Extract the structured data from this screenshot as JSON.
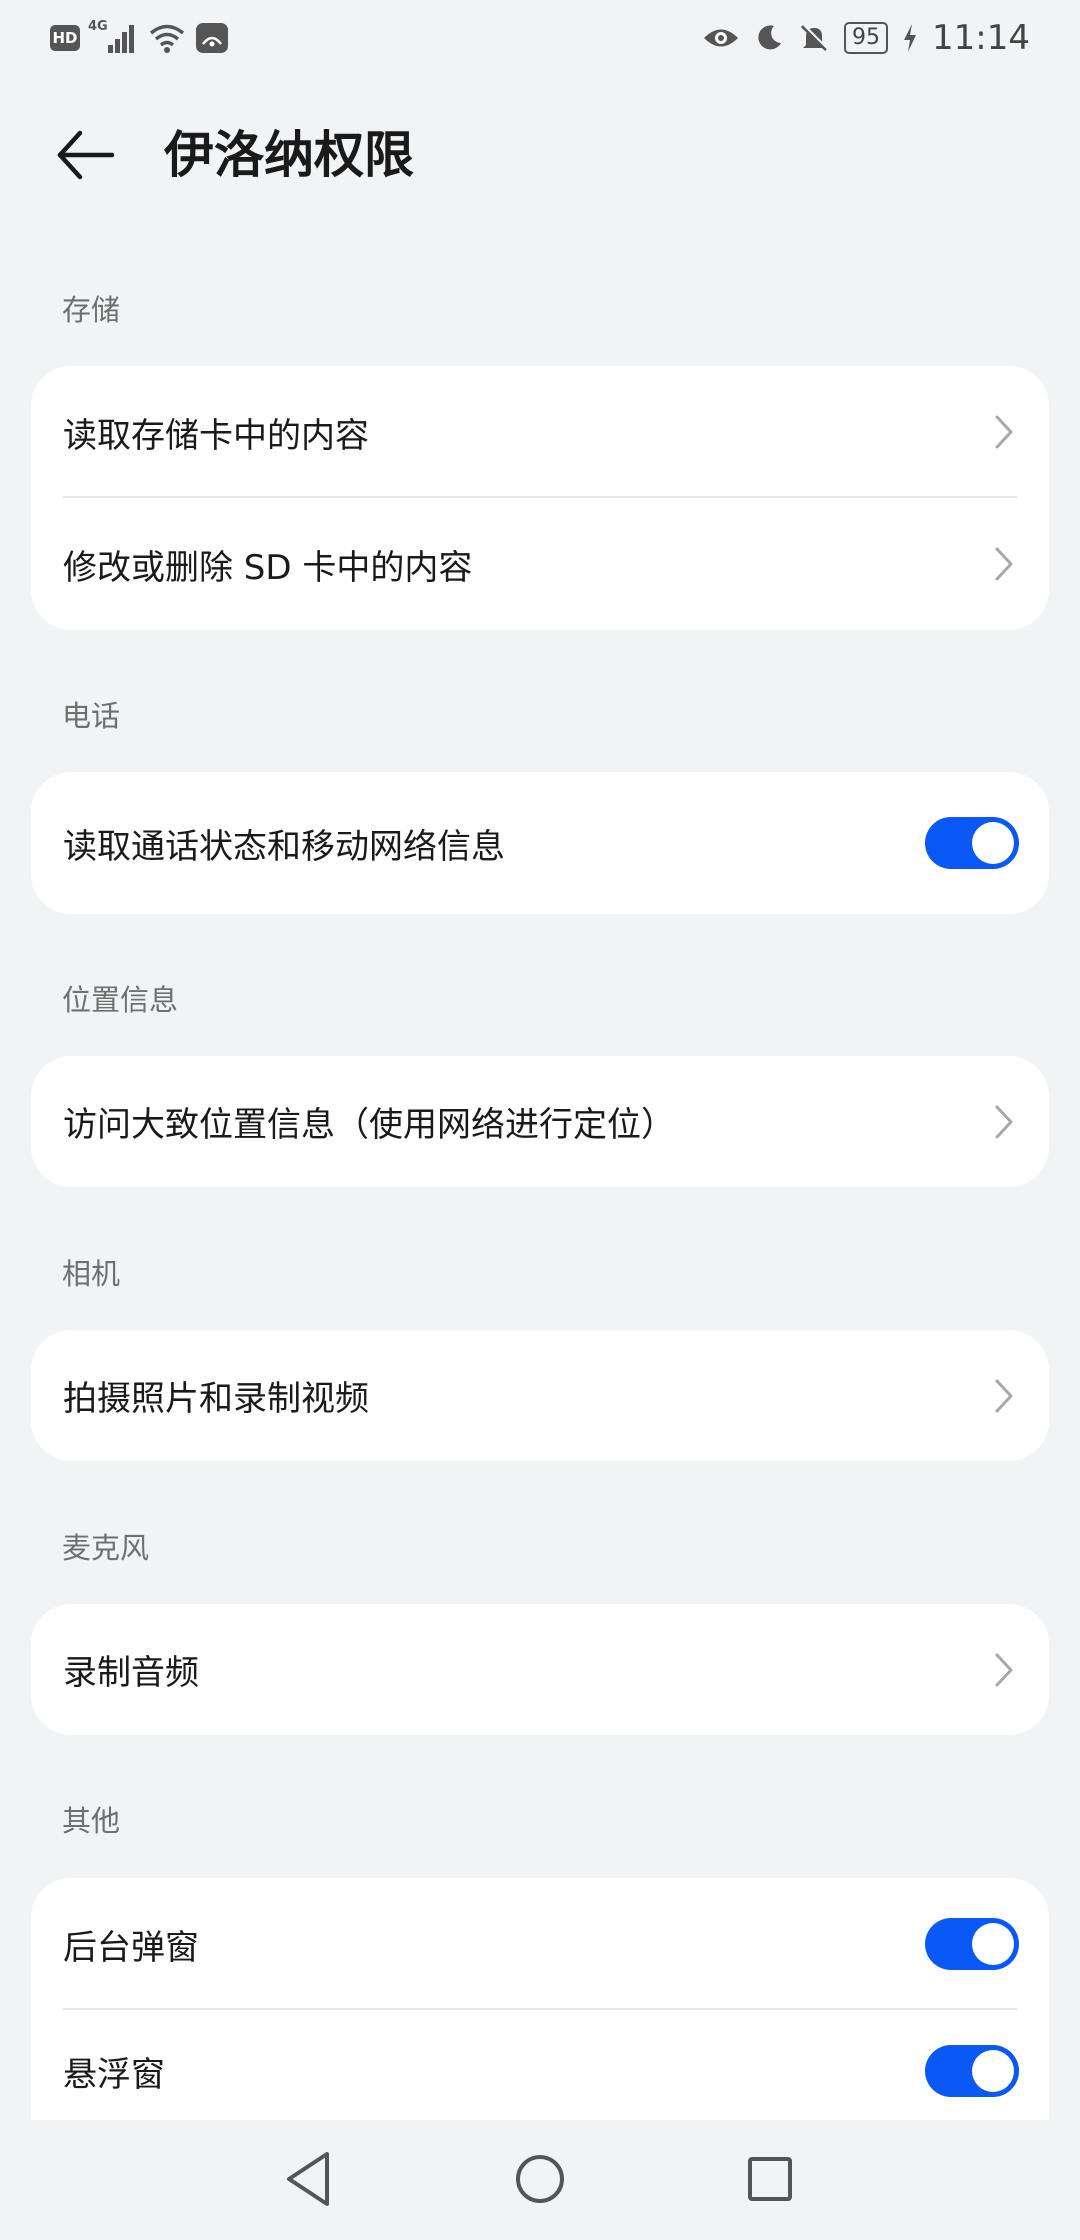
{
  "status_bar": {
    "hd": "HD",
    "network": "4G",
    "battery": "95",
    "time": "11:14"
  },
  "header": {
    "title": "伊洛纳权限"
  },
  "sections": [
    {
      "label": "存储",
      "items": [
        {
          "label": "读取存储卡中的内容",
          "control": "chevron"
        },
        {
          "label": "修改或删除 SD 卡中的内容",
          "control": "chevron"
        }
      ]
    },
    {
      "label": "电话",
      "items": [
        {
          "label": "读取通话状态和移动网络信息",
          "control": "toggle",
          "state": "on"
        }
      ]
    },
    {
      "label": "位置信息",
      "items": [
        {
          "label": "访问大致位置信息（使用网络进行定位）",
          "control": "chevron"
        }
      ]
    },
    {
      "label": "相机",
      "items": [
        {
          "label": "拍摄照片和录制视频",
          "control": "chevron"
        }
      ]
    },
    {
      "label": "麦克风",
      "items": [
        {
          "label": "录制音频",
          "control": "chevron"
        }
      ]
    },
    {
      "label": "其他",
      "items": [
        {
          "label": "后台弹窗",
          "control": "toggle",
          "state": "on"
        },
        {
          "label": "悬浮窗",
          "control": "toggle",
          "state": "on"
        }
      ]
    }
  ],
  "colors": {
    "accent": "#0a59f7",
    "background": "#f1f3f5",
    "card": "#ffffff"
  },
  "icons": {
    "back": "arrow-left-icon",
    "chevron": "chevron-right-icon",
    "nav_back": "triangle-back-icon",
    "nav_home": "circle-home-icon",
    "nav_recent": "square-recents-icon"
  }
}
